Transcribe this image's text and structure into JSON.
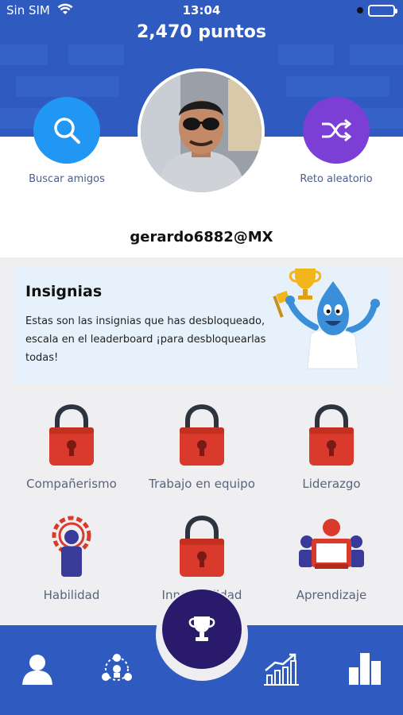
{
  "status_bar": {
    "carrier": "Sin SIM",
    "time": "13:04"
  },
  "header": {
    "points": "2,470 puntos"
  },
  "profile": {
    "search_friends_label": "Buscar amigos",
    "random_challenge_label": "Reto aleatorio",
    "username": "gerardo6882@MX"
  },
  "insignias": {
    "title": "Insignias",
    "description": "Estas son las insignias que has desbloqueado, escala en el leaderboard ¡para desbloquearlas todas!"
  },
  "badges": [
    {
      "label": "Compañerismo",
      "state": "locked"
    },
    {
      "label": "Trabajo en equipo",
      "state": "locked"
    },
    {
      "label": "Liderazgo",
      "state": "locked"
    },
    {
      "label": "Habilidad",
      "state": "unlocked"
    },
    {
      "label": "Innovabilidad",
      "state": "locked"
    },
    {
      "label": "Aprendizaje",
      "state": "unlocked"
    }
  ],
  "colors": {
    "primary": "#2f5bc0",
    "search_button": "#2196f3",
    "random_button": "#7b3fd6",
    "lock": "#d93a2b",
    "fab": "#2a1a6b"
  },
  "nav": {
    "icons": [
      "profile-icon",
      "network-icon",
      "trophy-icon",
      "growth-chart-icon",
      "bar-chart-icon"
    ]
  }
}
